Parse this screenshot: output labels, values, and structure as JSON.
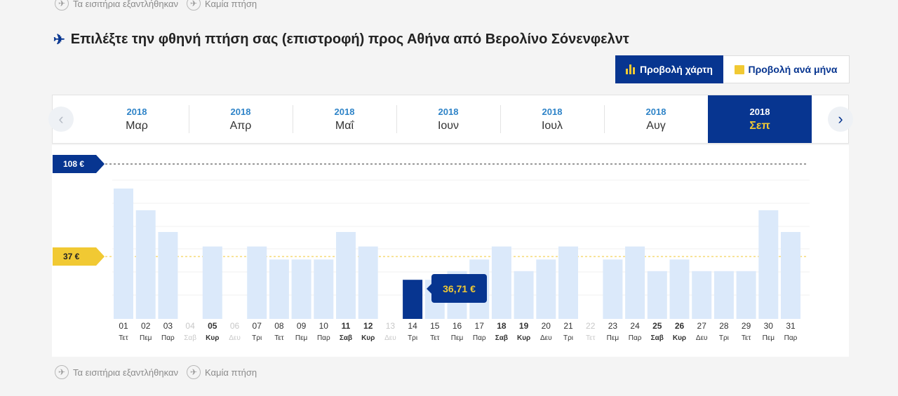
{
  "legend": {
    "sold_out": "Τα εισιτήρια εξαντλήθηκαν",
    "no_flight": "Καμία πτήση"
  },
  "header": {
    "title": "Επιλέξτε την φθηνή πτήση σας (επιστροφή) προς Αθήνα από Βερολίνο Σόνενφελντ"
  },
  "view_toggle": {
    "chart_label": "Προβολή χάρτη",
    "month_label": "Προβολή ανά μήνα"
  },
  "months": [
    {
      "year": "2018",
      "name": "Μαρ",
      "active": false
    },
    {
      "year": "2018",
      "name": "Απρ",
      "active": false
    },
    {
      "year": "2018",
      "name": "Μαΐ",
      "active": false
    },
    {
      "year": "2018",
      "name": "Ιουν",
      "active": false
    },
    {
      "year": "2018",
      "name": "Ιουλ",
      "active": false
    },
    {
      "year": "2018",
      "name": "Αυγ",
      "active": false
    },
    {
      "year": "2018",
      "name": "Σεπ",
      "active": true
    }
  ],
  "prices": {
    "max_label": "108 €",
    "avg_label": "37 €",
    "selected_label": "36,71 €"
  },
  "colors": {
    "brand_blue": "#073590",
    "accent_yellow": "#f1c933",
    "bar_light": "#dbe9fa",
    "year_blue": "#2f84c8"
  },
  "chart_data": {
    "type": "bar",
    "max_line": 108,
    "avg_line": 37,
    "selected_index": 13,
    "days": [
      {
        "day": "01",
        "dow": "Τετ",
        "price": 90,
        "weekend": false,
        "available": true
      },
      {
        "day": "02",
        "dow": "Πεμ",
        "price": 75,
        "weekend": false,
        "available": true
      },
      {
        "day": "03",
        "dow": "Παρ",
        "price": 60,
        "weekend": false,
        "available": true
      },
      {
        "day": "04",
        "dow": "Σαβ",
        "price": null,
        "weekend": true,
        "available": false
      },
      {
        "day": "05",
        "dow": "Κυρ",
        "price": 50,
        "weekend": true,
        "available": true
      },
      {
        "day": "06",
        "dow": "Δευ",
        "price": null,
        "weekend": false,
        "available": false
      },
      {
        "day": "07",
        "dow": "Τρι",
        "price": 50,
        "weekend": false,
        "available": true
      },
      {
        "day": "08",
        "dow": "Τετ",
        "price": 41,
        "weekend": false,
        "available": true
      },
      {
        "day": "09",
        "dow": "Πεμ",
        "price": 41,
        "weekend": false,
        "available": true
      },
      {
        "day": "10",
        "dow": "Παρ",
        "price": 41,
        "weekend": false,
        "available": true
      },
      {
        "day": "11",
        "dow": "Σαβ",
        "price": 60,
        "weekend": true,
        "available": true
      },
      {
        "day": "12",
        "dow": "Κυρ",
        "price": 50,
        "weekend": true,
        "available": true
      },
      {
        "day": "13",
        "dow": "Δευ",
        "price": null,
        "weekend": false,
        "available": false
      },
      {
        "day": "14",
        "dow": "Τρι",
        "price": 27,
        "weekend": false,
        "available": true
      },
      {
        "day": "15",
        "dow": "Τετ",
        "price": 27,
        "weekend": false,
        "available": true
      },
      {
        "day": "16",
        "dow": "Πεμ",
        "price": 33,
        "weekend": false,
        "available": true
      },
      {
        "day": "17",
        "dow": "Παρ",
        "price": 41,
        "weekend": false,
        "available": true
      },
      {
        "day": "18",
        "dow": "Σαβ",
        "price": 50,
        "weekend": true,
        "available": true
      },
      {
        "day": "19",
        "dow": "Κυρ",
        "price": 33,
        "weekend": true,
        "available": true
      },
      {
        "day": "20",
        "dow": "Δευ",
        "price": 41,
        "weekend": false,
        "available": true
      },
      {
        "day": "21",
        "dow": "Τρι",
        "price": 50,
        "weekend": false,
        "available": true
      },
      {
        "day": "22",
        "dow": "Τετ",
        "price": null,
        "weekend": false,
        "available": false
      },
      {
        "day": "23",
        "dow": "Πεμ",
        "price": 41,
        "weekend": false,
        "available": true
      },
      {
        "day": "24",
        "dow": "Παρ",
        "price": 50,
        "weekend": false,
        "available": true
      },
      {
        "day": "25",
        "dow": "Σαβ",
        "price": 33,
        "weekend": true,
        "available": true
      },
      {
        "day": "26",
        "dow": "Κυρ",
        "price": 41,
        "weekend": true,
        "available": true
      },
      {
        "day": "27",
        "dow": "Δευ",
        "price": 33,
        "weekend": false,
        "available": true
      },
      {
        "day": "28",
        "dow": "Τρι",
        "price": 33,
        "weekend": false,
        "available": true
      },
      {
        "day": "29",
        "dow": "Τετ",
        "price": 33,
        "weekend": false,
        "available": true
      },
      {
        "day": "30",
        "dow": "Πεμ",
        "price": 75,
        "weekend": false,
        "available": true
      },
      {
        "day": "31",
        "dow": "Παρ",
        "price": 60,
        "weekend": false,
        "available": true
      }
    ]
  }
}
